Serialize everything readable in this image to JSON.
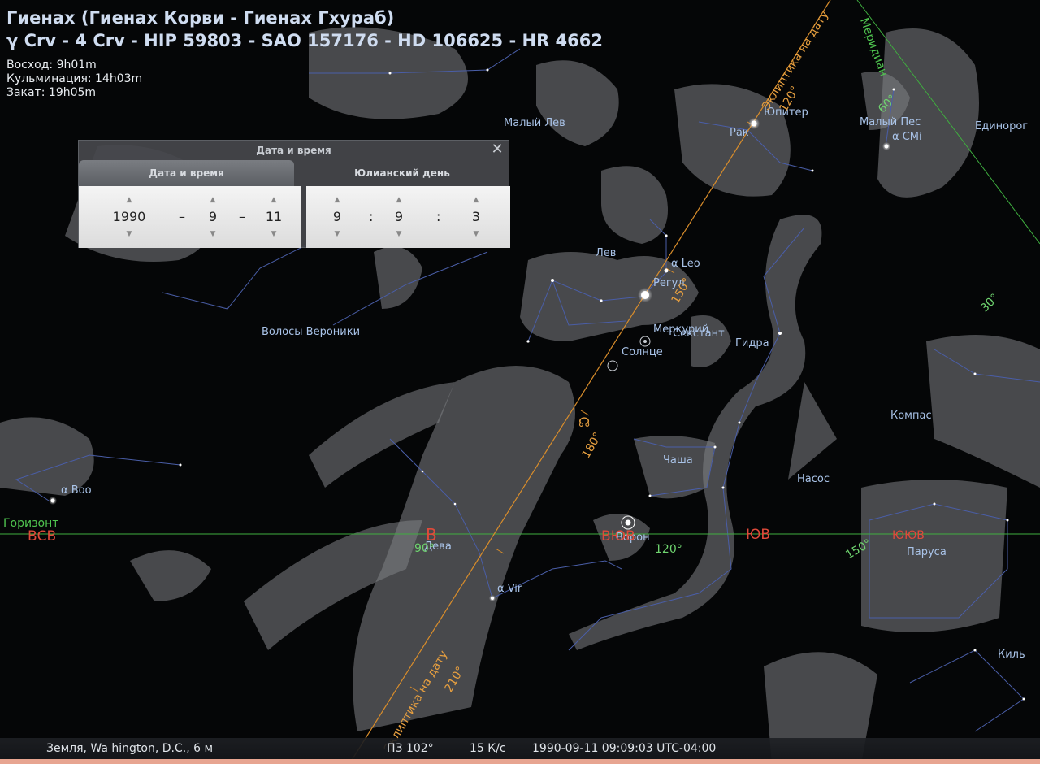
{
  "info": {
    "title_line1": "Гиенах (Гиенах Корви - Гиенах Гхураб)",
    "title_line2": "γ Crv - 4 Crv - HIP 59803 - SAO 157176 - HD 106625 - HR 4662",
    "rise": "Восход: 9h01m",
    "transit": "Кульминация: 14h03m",
    "set": "Закат: 19h05m"
  },
  "dialog": {
    "title": "Дата и время",
    "tab_date": "Дата и время",
    "tab_julian": "Юлианский день",
    "year": "1990",
    "month": "9",
    "day": "11",
    "hour": "9",
    "minute": "9",
    "second": "3",
    "date_sep": "–",
    "time_sep": ":"
  },
  "labels": {
    "malyi_lev": "Малый Лев",
    "yupiter": "Юпитер",
    "rak": "Рак",
    "malyi_pes": "Малый Пес",
    "a_cmi": "α CMi",
    "edinorog": "Единорог",
    "meridian": "Меридиан",
    "ecl_top": "Эклиптика на дату",
    "ecl_bottom": "Эклиптика на дату",
    "lev": "Лев",
    "a_leo": "α Leo",
    "regul": "Регул",
    "volosy": "Волосы Вероники",
    "merkuriy": "Меркурий",
    "sekstant": "Секстант",
    "solntse": "Солнце",
    "gidra": "Гидра",
    "kompas": "Компас",
    "chasha": "Чаша",
    "nasos": "Насос",
    "a_boo": "α Boo",
    "gorizont": "Горизонт",
    "vorone": "Ворон",
    "deva": "Дева",
    "parusa": "Паруса",
    "a_vir": "α Vir",
    "kil": "Киль",
    "sun_symbol": "♃",
    "asc_node": "☊"
  },
  "cardinals": {
    "vsv": "ВСВ",
    "v": "В",
    "vyuv": "ВЮВ",
    "yuv": "ЮВ",
    "yuyuv": "ЮЮВ"
  },
  "degrees": {
    "d60": "60°",
    "d30": "30°",
    "d90": "90°",
    "d120": "120°",
    "d150": "150°",
    "e120": "120°",
    "e150": "150°",
    "e180": "180°",
    "e210": "210°"
  },
  "status": {
    "location": "Земля, Wa hington, D.C., 6 м",
    "fov": "ПЗ 102°",
    "fps": "15 К/с",
    "datetime": "1990-09-11 09:09:03 UTC-04:00"
  },
  "colors": {
    "horizon": "#3fae3f",
    "ecliptic": "#d98d2b",
    "meridian": "#3fae3f",
    "constellation_lines": "#4a5ea8",
    "cardinal": "#e04a3a"
  }
}
